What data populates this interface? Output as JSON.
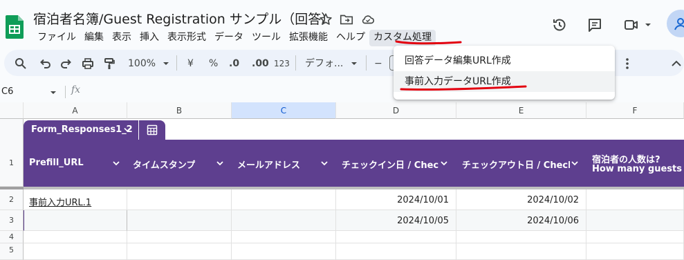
{
  "app": {
    "doc_title": "宿泊者名簿/Guest Registration サンプル（回答）",
    "menu": [
      "ファイル",
      "編集",
      "表示",
      "挿入",
      "表示形式",
      "データ",
      "ツール",
      "拡張機能",
      "ヘルプ",
      "カスタム処理"
    ],
    "active_menu": "カスタム処理"
  },
  "toolbar": {
    "zoom": "100%",
    "currency": "¥",
    "percent": "%",
    "decrease_decimals": ".0",
    "increase_decimals": ".00",
    "number_format": "123",
    "font": "デフォ...",
    "font_size_decrease": "−"
  },
  "formula_bar": {
    "cell_ref": "C6",
    "fx": "fx"
  },
  "dropdown": {
    "items": [
      "回答データ編集URL作成",
      "事前入力データURL作成"
    ],
    "hovered_index": 1
  },
  "columns": [
    "A",
    "B",
    "C",
    "D",
    "E",
    "F"
  ],
  "selected_column": "C",
  "rows": [
    "1",
    "2",
    "3",
    "4",
    "5"
  ],
  "table": {
    "tab_name": "Form_Responses1_2",
    "headers": [
      "Prefill_URL",
      "タイムスタンプ",
      "メールアドレス",
      "チェックイン日 / Check",
      "チェックアウト日 / Check",
      "宿泊者の人数は?"
    ],
    "header_f_line2": "How many guests is you",
    "data": [
      [
        "事前入力URL.1",
        "",
        "",
        "2024/10/01",
        "2024/10/02",
        ""
      ],
      [
        "",
        "",
        "",
        "2024/10/05",
        "2024/10/06",
        ""
      ]
    ]
  },
  "colors": {
    "header_purple": "#5e3f8f",
    "annotation_red": "#e3000f",
    "selected_col": "#d3e3fd"
  }
}
